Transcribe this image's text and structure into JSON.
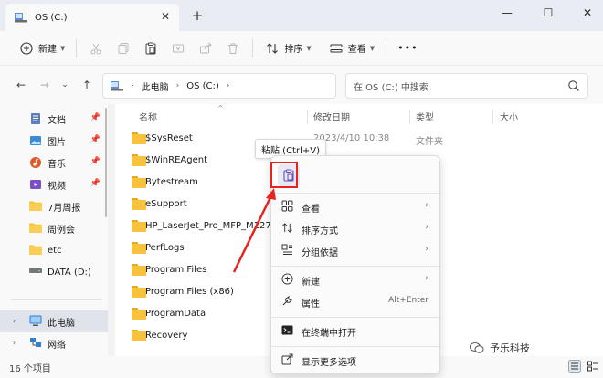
{
  "titlebar": {
    "tab_title": "OS (C:)",
    "close_tab": "✕",
    "new_tab": "+",
    "minimize": "—",
    "maximize": "☐",
    "close_window": "✕"
  },
  "toolbar": {
    "new_label": "新建",
    "sort_label": "排序",
    "view_label": "查看",
    "more_label": "•••"
  },
  "address": {
    "crumbs": [
      "此电脑",
      "OS (C:)"
    ],
    "search_placeholder": "在 OS (C:) 中搜索"
  },
  "sidebar": {
    "items": [
      {
        "label": "文档",
        "icon": "document-icon",
        "pinned": true
      },
      {
        "label": "图片",
        "icon": "picture-icon",
        "pinned": true
      },
      {
        "label": "音乐",
        "icon": "music-icon",
        "pinned": true
      },
      {
        "label": "视频",
        "icon": "video-icon",
        "pinned": true
      },
      {
        "label": "7月周报",
        "icon": "folder-icon",
        "pinned": false
      },
      {
        "label": "周例会",
        "icon": "folder-icon",
        "pinned": false
      },
      {
        "label": "etc",
        "icon": "folder-icon",
        "pinned": false
      },
      {
        "label": "DATA (D:)",
        "icon": "drive-icon",
        "pinned": false
      }
    ],
    "this_pc": "此电脑",
    "network": "网络"
  },
  "columns": {
    "name": "名称",
    "date": "修改日期",
    "type": "类型",
    "size": "大小"
  },
  "files": [
    {
      "name": "$SysReset",
      "date": "2023/4/10 10:38",
      "type": "文件夹"
    },
    {
      "name": "$WinREAgent",
      "date": "",
      "type": ""
    },
    {
      "name": "Bytestream",
      "date": "",
      "type": ""
    },
    {
      "name": "eSupport",
      "date": "",
      "type": ""
    },
    {
      "name": "HP_LaserJet_Pro_MFP_M127-M",
      "date": "",
      "type": ""
    },
    {
      "name": "PerfLogs",
      "date": "",
      "type": ""
    },
    {
      "name": "Program Files",
      "date": "",
      "type": ""
    },
    {
      "name": "Program Files (x86)",
      "date": "",
      "type": ""
    },
    {
      "name": "ProgramData",
      "date": "",
      "type": ""
    },
    {
      "name": "Recovery",
      "date": "",
      "type": ""
    }
  ],
  "status": {
    "count": "16 个项目"
  },
  "tooltip": {
    "text": "粘贴 (Ctrl+V)"
  },
  "context_menu": {
    "view": "查看",
    "sort": "排序方式",
    "group": "分组依据",
    "new": "新建",
    "properties": "属性",
    "properties_shortcut": "Alt+Enter",
    "terminal": "在终端中打开",
    "more_options": "显示更多选项"
  },
  "watermark": {
    "text": "予乐科技"
  },
  "colors": {
    "accent": "#0067c0",
    "folder": "#f7c23d",
    "arrow": "#e8231e",
    "paste_icon": "#6b4fbb"
  }
}
